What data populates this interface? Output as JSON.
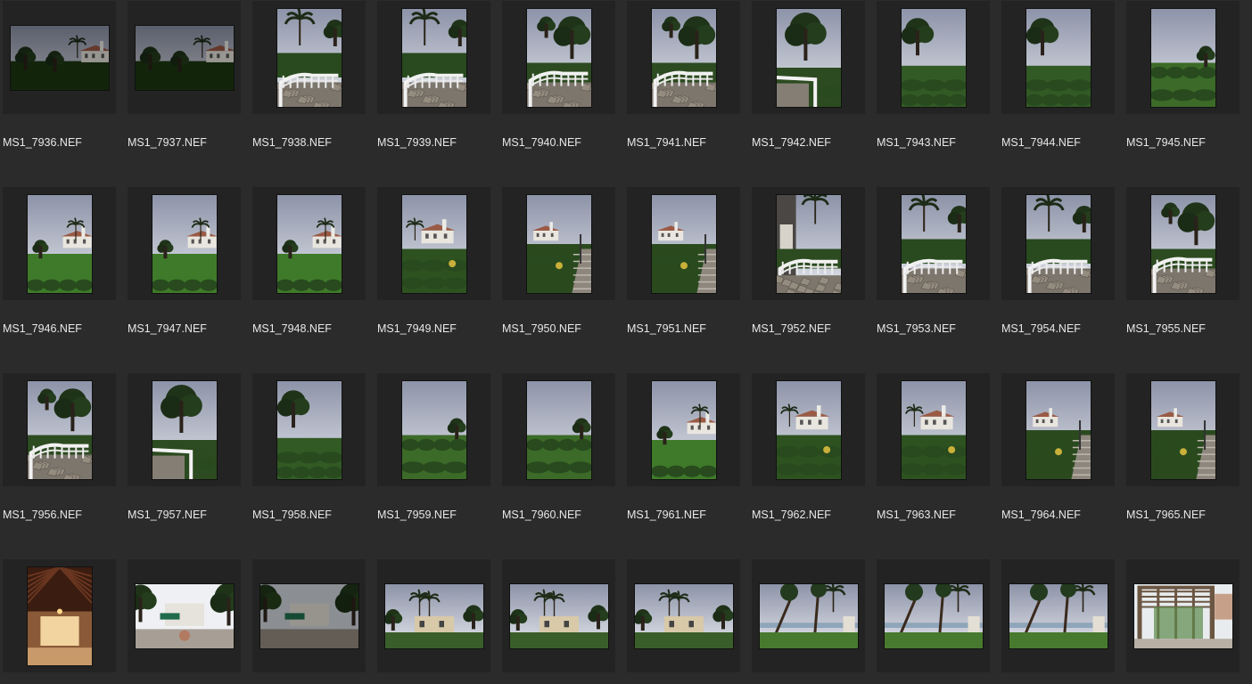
{
  "thumbnails": [
    {
      "filename": "MS1_7936.NEF",
      "orientation": "landscape",
      "scene": "house-dark"
    },
    {
      "filename": "MS1_7937.NEF",
      "orientation": "landscape",
      "scene": "house-dark"
    },
    {
      "filename": "MS1_7938.NEF",
      "orientation": "portrait",
      "scene": "palm-railing"
    },
    {
      "filename": "MS1_7939.NEF",
      "orientation": "portrait",
      "scene": "palm-railing"
    },
    {
      "filename": "MS1_7940.NEF",
      "orientation": "portrait",
      "scene": "tree-railing"
    },
    {
      "filename": "MS1_7941.NEF",
      "orientation": "portrait",
      "scene": "tree-railing"
    },
    {
      "filename": "MS1_7942.NEF",
      "orientation": "portrait",
      "scene": "tree-railing-left"
    },
    {
      "filename": "MS1_7943.NEF",
      "orientation": "portrait",
      "scene": "tree-hedge"
    },
    {
      "filename": "MS1_7944.NEF",
      "orientation": "portrait",
      "scene": "tree-hedge"
    },
    {
      "filename": "MS1_7945.NEF",
      "orientation": "portrait",
      "scene": "garden-sky"
    },
    {
      "filename": "MS1_7946.NEF",
      "orientation": "portrait",
      "scene": "house-lawn"
    },
    {
      "filename": "MS1_7947.NEF",
      "orientation": "portrait",
      "scene": "house-lawn"
    },
    {
      "filename": "MS1_7948.NEF",
      "orientation": "portrait",
      "scene": "house-lawn"
    },
    {
      "filename": "MS1_7949.NEF",
      "orientation": "portrait",
      "scene": "house-hedge"
    },
    {
      "filename": "MS1_7950.NEF",
      "orientation": "portrait",
      "scene": "house-steps"
    },
    {
      "filename": "MS1_7951.NEF",
      "orientation": "portrait",
      "scene": "house-steps"
    },
    {
      "filename": "MS1_7952.NEF",
      "orientation": "portrait",
      "scene": "porch-railing"
    },
    {
      "filename": "MS1_7953.NEF",
      "orientation": "portrait",
      "scene": "palm-railing"
    },
    {
      "filename": "MS1_7954.NEF",
      "orientation": "portrait",
      "scene": "palm-railing"
    },
    {
      "filename": "MS1_7955.NEF",
      "orientation": "portrait",
      "scene": "tree-railing"
    },
    {
      "filename": "MS1_7956.NEF",
      "orientation": "portrait",
      "scene": "tree-railing"
    },
    {
      "filename": "MS1_7957.NEF",
      "orientation": "portrait",
      "scene": "tree-railing-left"
    },
    {
      "filename": "MS1_7958.NEF",
      "orientation": "portrait",
      "scene": "tree-hedge"
    },
    {
      "filename": "MS1_7959.NEF",
      "orientation": "portrait",
      "scene": "garden-sky"
    },
    {
      "filename": "MS1_7960.NEF",
      "orientation": "portrait",
      "scene": "garden-sky"
    },
    {
      "filename": "MS1_7961.NEF",
      "orientation": "portrait",
      "scene": "house-lawn"
    },
    {
      "filename": "MS1_7962.NEF",
      "orientation": "portrait",
      "scene": "house-hedge"
    },
    {
      "filename": "MS1_7963.NEF",
      "orientation": "portrait",
      "scene": "house-hedge"
    },
    {
      "filename": "MS1_7964.NEF",
      "orientation": "portrait",
      "scene": "house-steps"
    },
    {
      "filename": "MS1_7965.NEF",
      "orientation": "portrait",
      "scene": "house-steps"
    },
    {
      "filename": "",
      "orientation": "portrait",
      "scene": "interior-hall"
    },
    {
      "filename": "",
      "orientation": "landscape",
      "scene": "courtyard"
    },
    {
      "filename": "",
      "orientation": "landscape",
      "scene": "courtyard-dark"
    },
    {
      "filename": "",
      "orientation": "landscape",
      "scene": "villa-palms"
    },
    {
      "filename": "",
      "orientation": "landscape",
      "scene": "villa-palms"
    },
    {
      "filename": "",
      "orientation": "landscape",
      "scene": "villa-palms"
    },
    {
      "filename": "",
      "orientation": "landscape",
      "scene": "pines-ocean"
    },
    {
      "filename": "",
      "orientation": "landscape",
      "scene": "pines-ocean"
    },
    {
      "filename": "",
      "orientation": "landscape",
      "scene": "pines-ocean"
    },
    {
      "filename": "",
      "orientation": "landscape",
      "scene": "pergola"
    }
  ]
}
